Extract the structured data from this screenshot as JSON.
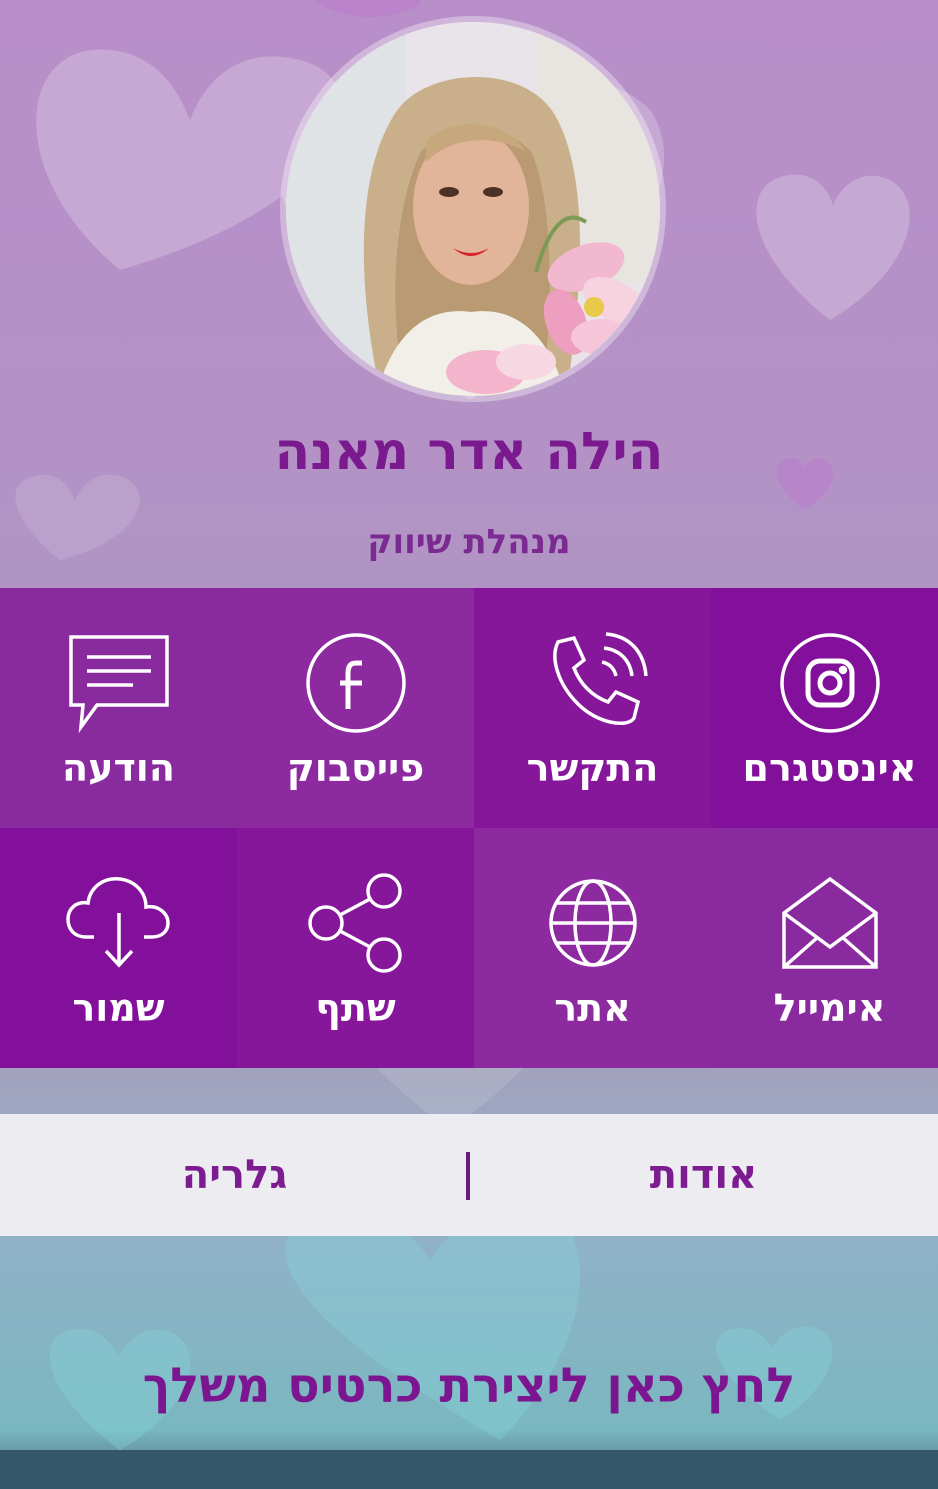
{
  "profile": {
    "name": "הילה אדר מאנה",
    "title": "מנהלת שיווק"
  },
  "actions": [
    {
      "key": "message",
      "label": "הודעה",
      "icon": "message-icon",
      "color": "#8a2a9f"
    },
    {
      "key": "facebook",
      "label": "פייסבוק",
      "icon": "facebook-icon",
      "color": "#8d2aa0"
    },
    {
      "key": "call",
      "label": "התקשר",
      "icon": "phone-icon",
      "color": "#86179b"
    },
    {
      "key": "instagram",
      "label": "אינסטגרם",
      "icon": "instagram-icon",
      "color": "#82109a"
    },
    {
      "key": "save",
      "label": "שמור",
      "icon": "cloud-download-icon",
      "color": "#82109a"
    },
    {
      "key": "share",
      "label": "שתף",
      "icon": "share-icon",
      "color": "#86179b"
    },
    {
      "key": "website",
      "label": "אתר",
      "icon": "globe-icon",
      "color": "#8d2aa0"
    },
    {
      "key": "email",
      "label": "אימייל",
      "icon": "envelope-icon",
      "color": "#8a2a9f"
    }
  ],
  "tabs": {
    "about": "אודות",
    "gallery": "גלריה"
  },
  "cta": "לחץ כאן ליצירת כרטיס משלך"
}
